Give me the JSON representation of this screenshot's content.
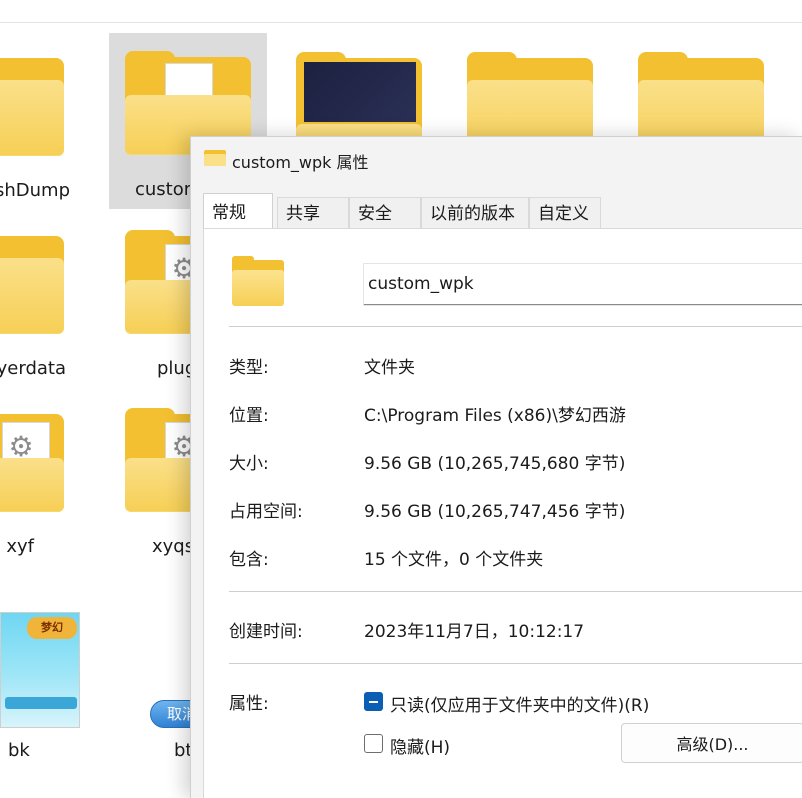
{
  "explorer": {
    "tiles": [
      {
        "label": "shDump"
      },
      {
        "label": "custom"
      },
      {
        "label": ""
      },
      {
        "label": ""
      },
      {
        "label": ""
      },
      {
        "label": "yerdata"
      },
      {
        "label": "plug"
      },
      {
        "label": "xyf"
      },
      {
        "label": "xyqs"
      },
      {
        "label": "bk"
      },
      {
        "label": "bt"
      }
    ],
    "thumb_logo": "梦幻",
    "cancel_pill": "取消"
  },
  "dialog": {
    "title": "custom_wpk 属性",
    "tabs": [
      {
        "label": "常规",
        "active": true
      },
      {
        "label": "共享"
      },
      {
        "label": "安全"
      },
      {
        "label": "以前的版本"
      },
      {
        "label": "自定义"
      }
    ],
    "name_value": "custom_wpk",
    "rows": [
      {
        "label": "类型:",
        "value": "文件夹"
      },
      {
        "label": "位置:",
        "value": "C:\\Program Files (x86)\\梦幻西游"
      },
      {
        "label": "大小:",
        "value": "9.56 GB (10,265,745,680 字节)"
      },
      {
        "label": "占用空间:",
        "value": "9.56 GB (10,265,747,456 字节)"
      },
      {
        "label": "包含:",
        "value": "15 个文件，0 个文件夹"
      }
    ],
    "created": {
      "label": "创建时间:",
      "value": "2023年11月7日，10:12:17"
    },
    "attributes": {
      "label": "属性:",
      "readonly": "只读(仅应用于文件夹中的文件)(R)",
      "hidden": "隐藏(H)",
      "advanced": "高级(D)..."
    }
  },
  "colors": {
    "accent": "#0a5fb4",
    "folder": "#f3c032",
    "folder_front": "#fbe08a",
    "selected_tile": "#dcdcdc"
  }
}
